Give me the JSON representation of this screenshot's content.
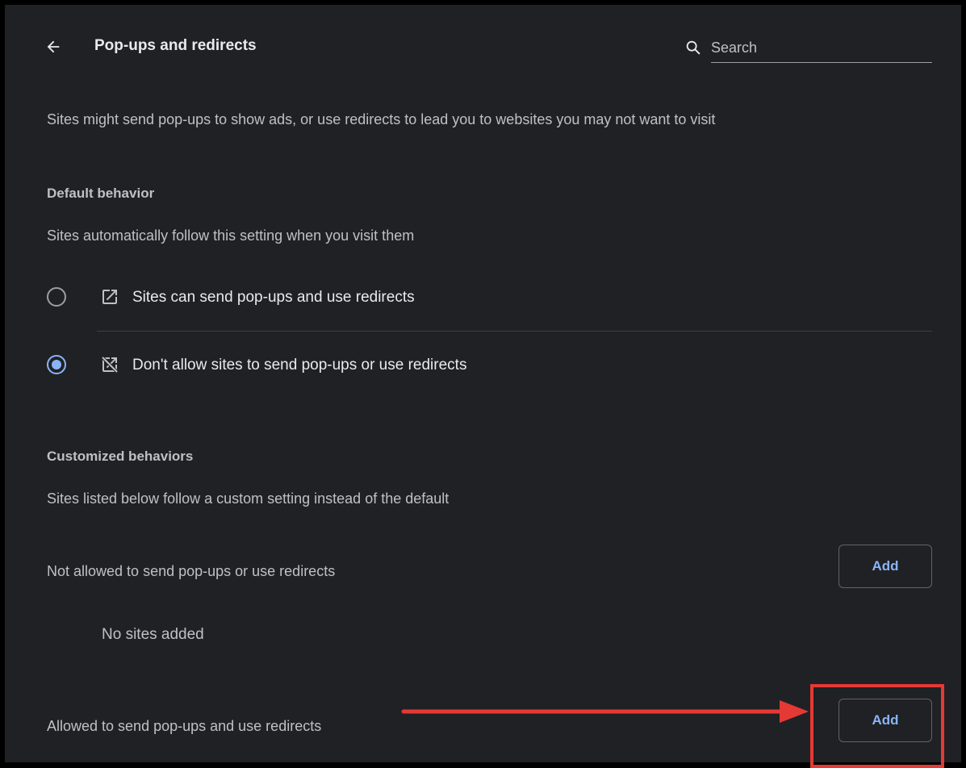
{
  "header": {
    "back_icon": "arrow-left-icon",
    "title": "Pop-ups and redirects",
    "search": {
      "icon": "search-icon",
      "placeholder": "Search",
      "value": ""
    }
  },
  "description": "Sites might send pop-ups to show ads, or use redirects to lead you to websites you may not want to visit",
  "default_behavior": {
    "heading": "Default behavior",
    "subtext": "Sites automatically follow this setting when you visit them",
    "options": [
      {
        "label": "Sites can send pop-ups and use redirects",
        "icon": "open-in-new-icon",
        "selected": false
      },
      {
        "label": "Don't allow sites to send pop-ups or use redirects",
        "icon": "open-in-new-off-icon",
        "selected": true
      }
    ]
  },
  "customized_behaviors": {
    "heading": "Customized behaviors",
    "subtext": "Sites listed below follow a custom setting instead of the default",
    "not_allowed": {
      "label": "Not allowed to send pop-ups or use redirects",
      "add_label": "Add",
      "empty_text": "No sites added"
    },
    "allowed": {
      "label": "Allowed to send pop-ups and use redirects",
      "add_label": "Add"
    }
  },
  "colors": {
    "background": "#202124",
    "accent": "#8ab4f8",
    "annotation": "#e53935"
  }
}
